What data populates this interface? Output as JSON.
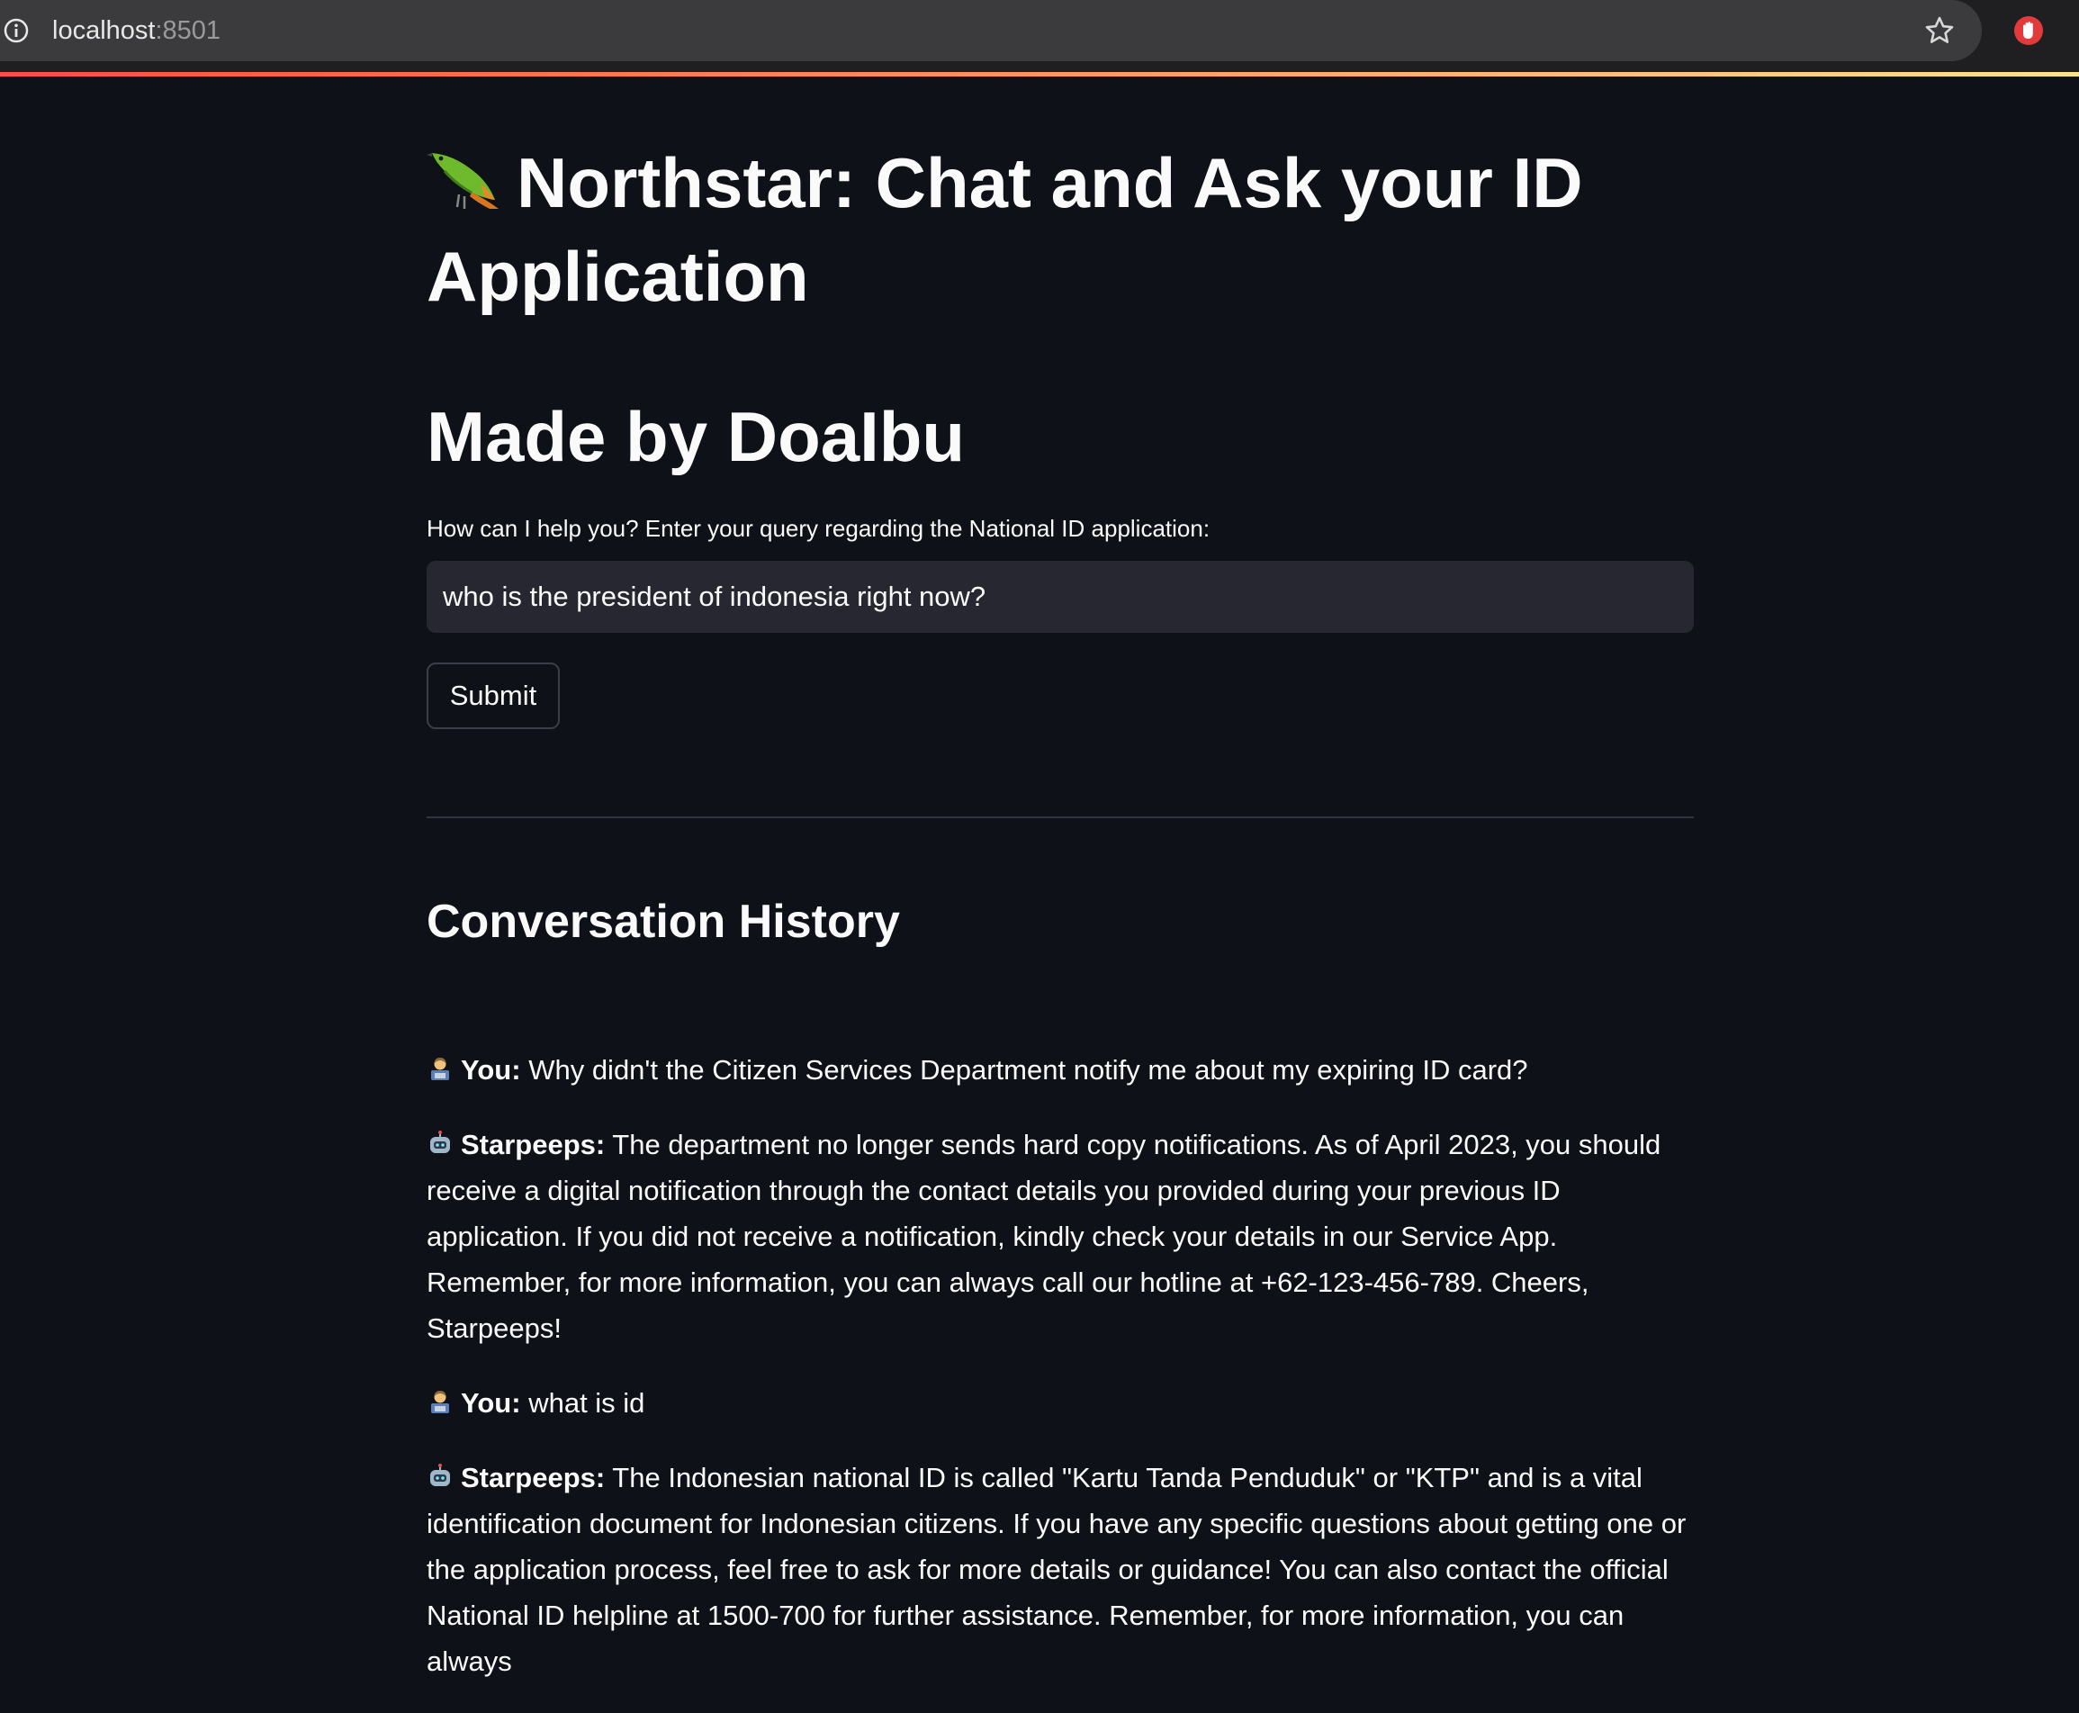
{
  "browser": {
    "url_host": "localhost",
    "url_port": ":8501"
  },
  "header": {
    "title": "Northstar: Chat and Ask your ID Application",
    "title_icon": "bird-emoji",
    "subtitle": "Made by DoaIbu"
  },
  "form": {
    "label": "How can I help you? Enter your query regarding the National ID application:",
    "input_value": "who is the president of indonesia right now?",
    "submit_label": "Submit"
  },
  "history": {
    "title": "Conversation History",
    "messages": [
      {
        "icon": "user-technologist-icon",
        "speaker": "You:",
        "text": "Why didn't the Citizen Services Department notify me about my expiring ID card?"
      },
      {
        "icon": "robot-icon",
        "speaker": "Starpeeps:",
        "text": "The department no longer sends hard copy notifications. As of April 2023, you should receive a digital notification through the contact details you provided during your previous ID application. If you did not receive a notification, kindly check your details in our Service App. Remember, for more information, you can always call our hotline at +62-123-456-789. Cheers, Starpeeps!"
      },
      {
        "icon": "user-technologist-icon",
        "speaker": "You:",
        "text": "what is id"
      },
      {
        "icon": "robot-icon",
        "speaker": "Starpeeps:",
        "text": "The Indonesian national ID is called \"Kartu Tanda Penduduk\" or \"KTP\" and is a vital identification document for Indonesian citizens. If you have any specific questions about getting one or the application process, feel free to ask for more details or guidance! You can also contact the official National ID helpline at 1500-700 for further assistance. Remember, for more information, you can always"
      }
    ]
  },
  "colors": {
    "background": "#0e1117",
    "input_background": "#262730",
    "accent": "#ff4b4b"
  }
}
